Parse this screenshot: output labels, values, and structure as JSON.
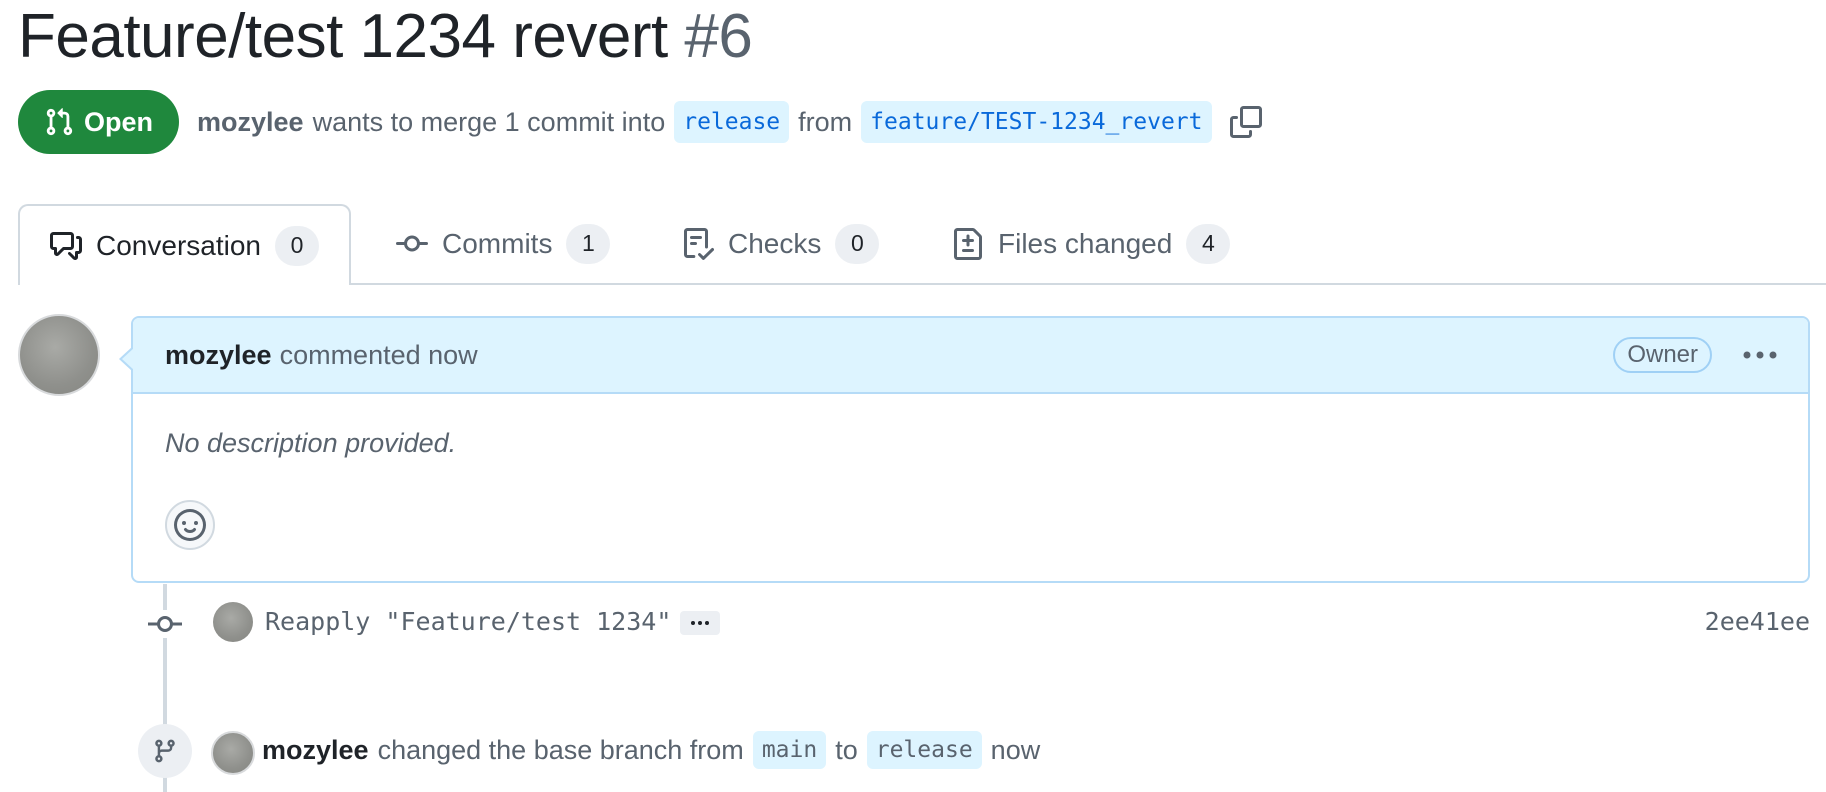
{
  "pr": {
    "title": "Feature/test 1234 revert",
    "number": "#6",
    "state_label": "Open",
    "author": "mozylee",
    "merge_text_1": "wants to merge 1 commit into",
    "base_branch": "release",
    "merge_text_2": "from",
    "head_branch": "feature/TEST-1234_revert"
  },
  "tabs": [
    {
      "label": "Conversation",
      "count": "0",
      "icon": "comment-discussion-icon"
    },
    {
      "label": "Commits",
      "count": "1",
      "icon": "git-commit-icon"
    },
    {
      "label": "Checks",
      "count": "0",
      "icon": "checklist-icon"
    },
    {
      "label": "Files changed",
      "count": "4",
      "icon": "file-diff-icon"
    }
  ],
  "comment": {
    "author": "mozylee",
    "action": "commented now",
    "role_badge": "Owner",
    "body": "No description provided."
  },
  "commit": {
    "message": "Reapply \"Feature/test 1234\"",
    "sha": "2ee41ee"
  },
  "base_change": {
    "author": "mozylee",
    "text_1": "changed the base branch from",
    "from_branch": "main",
    "text_2": "to",
    "to_branch": "release",
    "time": "now"
  },
  "colors": {
    "open_green": "#1f883d",
    "branch_bg": "#ddf4ff",
    "branch_fg": "#0969da",
    "comment_header_bg": "#ddf4ff"
  }
}
